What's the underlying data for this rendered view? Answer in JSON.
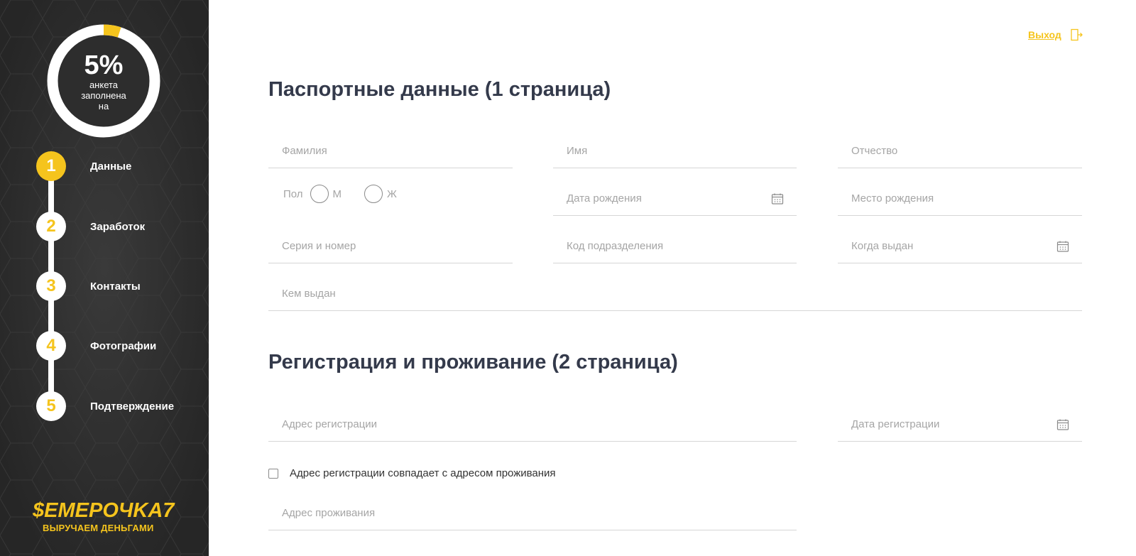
{
  "sidebar": {
    "progress": {
      "percent_text": "5%",
      "percent_value": 5,
      "label_line1": "анкета",
      "label_line2": "заполнена",
      "label_line3": "на"
    },
    "steps": [
      {
        "number": "1",
        "label": "Данные",
        "active": true
      },
      {
        "number": "2",
        "label": "Заработок",
        "active": false
      },
      {
        "number": "3",
        "label": "Контакты",
        "active": false
      },
      {
        "number": "4",
        "label": "Фотографии",
        "active": false
      },
      {
        "number": "5",
        "label": "Подтверждение",
        "active": false
      }
    ],
    "logo": {
      "main": "$EMEPOЧKA7",
      "tagline": "ВЫРУЧАЕМ ДЕНЬГАМИ"
    }
  },
  "header": {
    "logout_label": "Выход",
    "logout_icon": "logout-door-icon"
  },
  "passport": {
    "title": "Паспортные данные (1 страница)",
    "surname_placeholder": "Фамилия",
    "name_placeholder": "Имя",
    "patronymic_placeholder": "Отчество",
    "gender_label": "Пол",
    "gender_male": "М",
    "gender_female": "Ж",
    "birth_date_placeholder": "Дата рождения",
    "birth_place_placeholder": "Место рождения",
    "series_number_placeholder": "Серия и номер",
    "division_code_placeholder": "Код подразделения",
    "issue_date_placeholder": "Когда выдан",
    "issued_by_placeholder": "Кем выдан"
  },
  "registration": {
    "title": "Регистрация и проживание (2 страница)",
    "address_placeholder": "Адрес регистрации",
    "date_placeholder": "Дата регистрации",
    "same_address_label": "Адрес регистрации совпадает с адресом проживания",
    "residence_placeholder": "Адрес проживания"
  },
  "colors": {
    "accent": "#f5c41d",
    "sidebar_bg": "#2d2d2d",
    "title": "#343a4b",
    "placeholder": "#a5a5a5"
  }
}
